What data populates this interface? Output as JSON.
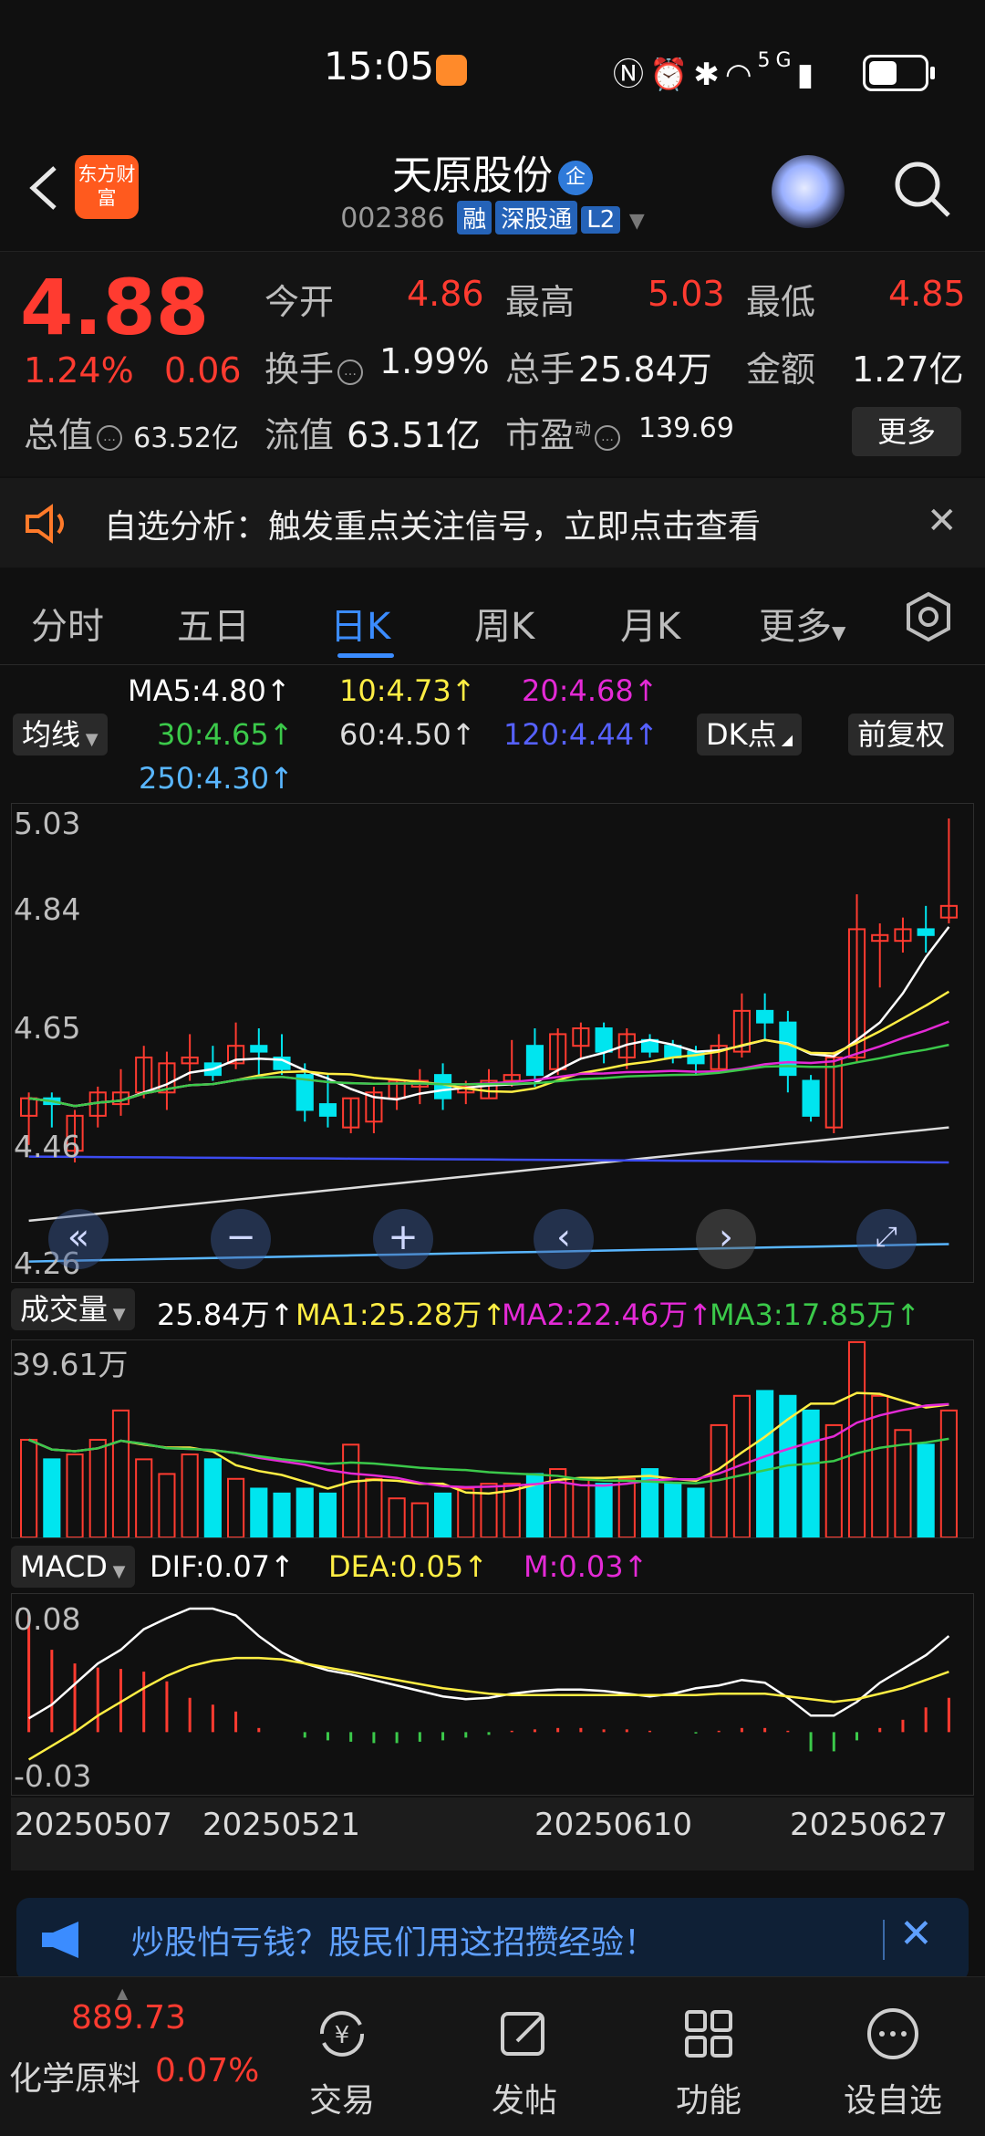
{
  "status_bar": {
    "time": "15:05",
    "icons": "NFC alarm bluetooth wifi 5G signal battery",
    "network": "5G"
  },
  "header": {
    "back_icon": "chevron-left",
    "app_logo": "东方财富",
    "stock_name": "天原股份",
    "enterprise_badge": "企",
    "stock_code": "002386",
    "tags": [
      "融",
      "深股通",
      "L2"
    ]
  },
  "quote": {
    "price": "4.88",
    "change_pct": "1.24%",
    "change": "0.06",
    "total_value_label": "总值",
    "total_value": "63.52亿",
    "open_label": "今开",
    "open": "4.86",
    "high_label": "最高",
    "high": "5.03",
    "low_label": "最低",
    "low": "4.85",
    "turnover_label": "换手",
    "turnover": "1.99%",
    "volume_label": "总手",
    "volume": "25.84万",
    "amount_label": "金额",
    "amount": "1.27亿",
    "float_value_label": "流值",
    "float_value": "63.51亿",
    "pe_label": "市盈",
    "pe_sup": "动",
    "pe": "139.69",
    "more_label": "更多"
  },
  "notice": {
    "text": "自选分析：触发重点关注信号，立即点击查看"
  },
  "tabs": [
    {
      "label": "分时",
      "active": false
    },
    {
      "label": "五日",
      "active": false
    },
    {
      "label": "日K",
      "active": true
    },
    {
      "label": "周K",
      "active": false
    },
    {
      "label": "月K",
      "active": false
    },
    {
      "label": "更多",
      "active": false
    }
  ],
  "ma_legend": {
    "ma5": "MA5:4.80↑",
    "ma10": "10:4.73↑",
    "ma20": "20:4.68↑",
    "ma30": "30:4.65↑",
    "ma60": "60:4.50↑",
    "ma120": "120:4.44↑",
    "ma250": "250:4.30↑",
    "selector": "均线",
    "dk_button": "DK点",
    "adjust_button": "前复权"
  },
  "kline_axis": [
    "5.03",
    "4.84",
    "4.65",
    "4.46",
    "4.26"
  ],
  "volume_legend": {
    "selector": "成交量",
    "vol": "25.84万↑",
    "ma1": "MA1:25.28万↑",
    "ma2": "MA2:22.46万↑",
    "ma3": "MA3:17.85万↑",
    "max_label": "39.61万"
  },
  "macd_legend": {
    "selector": "MACD",
    "dif": "DIF:0.07↑",
    "dea": "DEA:0.05↑",
    "m": "M:0.03↑",
    "top_label": "0.08",
    "bottom_label": "-0.03"
  },
  "dates": [
    "20250507",
    "20250521",
    "20250610",
    "20250627"
  ],
  "colors": {
    "up": "#ff3b30",
    "down": "#00e5ef",
    "accent": "#3b8cff",
    "ma5": "#ffffff",
    "ma10": "#ffee44",
    "ma20": "#e42ad6",
    "ma30": "#3bc94a",
    "ma60": "#dcdcdc",
    "ma120": "#3c4bf0",
    "ma250": "#59b6ff"
  },
  "ad": {
    "text": "炒股怕亏钱？股民们用这招攒经验！"
  },
  "bottom_nav": {
    "index_value": "889.73",
    "index_name": "化学原料",
    "index_change": "0.07%",
    "items": [
      "交易",
      "发帖",
      "功能",
      "设自选"
    ]
  },
  "chart_data": [
    {
      "type": "candlestick",
      "title": "",
      "ylim": [
        4.26,
        5.03
      ],
      "y_ticks": [
        5.03,
        4.84,
        4.65,
        4.46,
        4.26
      ],
      "candles": [
        {
          "o": 4.52,
          "h": 4.56,
          "l": 4.47,
          "c": 4.55
        },
        {
          "o": 4.55,
          "h": 4.56,
          "l": 4.5,
          "c": 4.54
        },
        {
          "o": 4.46,
          "h": 4.53,
          "l": 4.44,
          "c": 4.52
        },
        {
          "o": 4.52,
          "h": 4.57,
          "l": 4.5,
          "c": 4.56
        },
        {
          "o": 4.54,
          "h": 4.6,
          "l": 4.52,
          "c": 4.56
        },
        {
          "o": 4.56,
          "h": 4.64,
          "l": 4.55,
          "c": 4.62
        },
        {
          "o": 4.56,
          "h": 4.63,
          "l": 4.53,
          "c": 4.61
        },
        {
          "o": 4.61,
          "h": 4.66,
          "l": 4.58,
          "c": 4.62
        },
        {
          "o": 4.61,
          "h": 4.64,
          "l": 4.58,
          "c": 4.59
        },
        {
          "o": 4.61,
          "h": 4.68,
          "l": 4.6,
          "c": 4.64
        },
        {
          "o": 4.64,
          "h": 4.67,
          "l": 4.59,
          "c": 4.63
        },
        {
          "o": 4.62,
          "h": 4.66,
          "l": 4.59,
          "c": 4.6
        },
        {
          "o": 4.59,
          "h": 4.61,
          "l": 4.51,
          "c": 4.53
        },
        {
          "o": 4.54,
          "h": 4.59,
          "l": 4.5,
          "c": 4.52
        },
        {
          "o": 4.5,
          "h": 4.55,
          "l": 4.49,
          "c": 4.55
        },
        {
          "o": 4.51,
          "h": 4.57,
          "l": 4.49,
          "c": 4.56
        },
        {
          "o": 4.55,
          "h": 4.58,
          "l": 4.53,
          "c": 4.58
        },
        {
          "o": 4.57,
          "h": 4.6,
          "l": 4.54,
          "c": 4.58
        },
        {
          "o": 4.59,
          "h": 4.61,
          "l": 4.53,
          "c": 4.55
        },
        {
          "o": 4.56,
          "h": 4.58,
          "l": 4.54,
          "c": 4.57
        },
        {
          "o": 4.55,
          "h": 4.6,
          "l": 4.55,
          "c": 4.58
        },
        {
          "o": 4.58,
          "h": 4.65,
          "l": 4.57,
          "c": 4.59
        },
        {
          "o": 4.64,
          "h": 4.67,
          "l": 4.57,
          "c": 4.59
        },
        {
          "o": 4.6,
          "h": 4.67,
          "l": 4.59,
          "c": 4.66
        },
        {
          "o": 4.64,
          "h": 4.68,
          "l": 4.62,
          "c": 4.67
        },
        {
          "o": 4.67,
          "h": 4.68,
          "l": 4.61,
          "c": 4.63
        },
        {
          "o": 4.62,
          "h": 4.67,
          "l": 4.6,
          "c": 4.66
        },
        {
          "o": 4.65,
          "h": 4.66,
          "l": 4.62,
          "c": 4.63
        },
        {
          "o": 4.64,
          "h": 4.65,
          "l": 4.61,
          "c": 4.62
        },
        {
          "o": 4.63,
          "h": 4.64,
          "l": 4.59,
          "c": 4.61
        },
        {
          "o": 4.6,
          "h": 4.66,
          "l": 4.6,
          "c": 4.64
        },
        {
          "o": 4.63,
          "h": 4.73,
          "l": 4.62,
          "c": 4.7
        },
        {
          "o": 4.7,
          "h": 4.73,
          "l": 4.65,
          "c": 4.68
        },
        {
          "o": 4.68,
          "h": 4.7,
          "l": 4.56,
          "c": 4.59
        },
        {
          "o": 4.58,
          "h": 4.59,
          "l": 4.51,
          "c": 4.52
        },
        {
          "o": 4.5,
          "h": 4.63,
          "l": 4.49,
          "c": 4.62
        },
        {
          "o": 4.62,
          "h": 4.9,
          "l": 4.61,
          "c": 4.84
        },
        {
          "o": 4.82,
          "h": 4.85,
          "l": 4.74,
          "c": 4.83
        },
        {
          "o": 4.82,
          "h": 4.86,
          "l": 4.8,
          "c": 4.84
        },
        {
          "o": 4.84,
          "h": 4.88,
          "l": 4.8,
          "c": 4.83
        },
        {
          "o": 4.86,
          "h": 5.03,
          "l": 4.85,
          "c": 4.88
        }
      ]
    },
    {
      "type": "bar",
      "title": "成交量",
      "ylim": [
        0,
        39.61
      ],
      "values": [
        20,
        16,
        17,
        20,
        26,
        16,
        13,
        17,
        16,
        12,
        10,
        9,
        10,
        9,
        19,
        12,
        8,
        7,
        9,
        10,
        11,
        11,
        13,
        14,
        12,
        11,
        12,
        14,
        11,
        10,
        23,
        29,
        30,
        29,
        26,
        23,
        40,
        29,
        22,
        19,
        26
      ],
      "unit": "万"
    },
    {
      "type": "bar",
      "title": "MACD",
      "ylim": [
        -0.03,
        0.08
      ],
      "values": [
        0.085,
        0.06,
        0.05,
        0.047,
        0.046,
        0.044,
        0.037,
        0.025,
        0.02,
        0.015,
        0.003,
        0.0,
        -0.004,
        -0.006,
        -0.007,
        -0.008,
        -0.008,
        -0.007,
        -0.006,
        -0.004,
        -0.002,
        0.001,
        0.002,
        0.003,
        0.003,
        0.002,
        0.002,
        0.001,
        0.0,
        -0.001,
        0.001,
        0.003,
        0.003,
        0.001,
        -0.014,
        -0.014,
        -0.006,
        0.003,
        0.009,
        0.018,
        0.025
      ]
    }
  ]
}
